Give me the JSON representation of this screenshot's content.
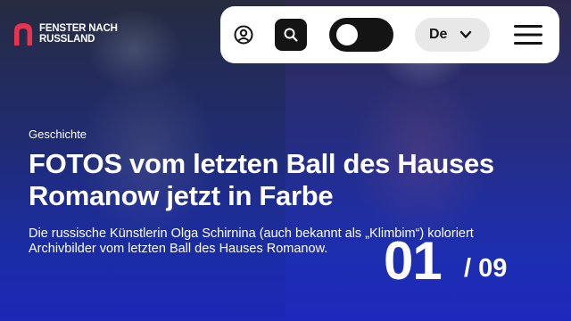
{
  "logo": {
    "line1": "FENSTER NACH",
    "line2": "RUSSLAND",
    "icon": "logo-arch-icon",
    "accent_color": "#e8334a"
  },
  "toolbar": {
    "account_icon": "user-circle-icon",
    "search_icon": "search-icon",
    "theme_toggle": "on",
    "language": "De",
    "language_icon": "chevron-down-icon",
    "menu_icon": "hamburger-menu-icon"
  },
  "slide": {
    "category": "Geschichte",
    "title": "FOTOS vom letzten Ball des Hauses Romanow jetzt in Farbe",
    "description": "Die russische Künstlerin Olga Schirnina (auch bekannt als „Klimbim“) koloriert Archivbilder vom letzten Ball des Hauses Romanow.",
    "current": "01",
    "total": "/ 09"
  }
}
